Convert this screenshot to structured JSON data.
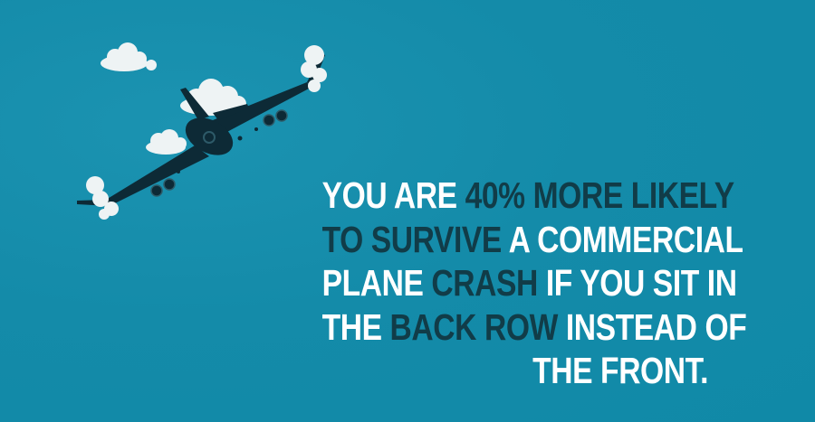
{
  "fact": {
    "lines": [
      [
        {
          "text": "YOU ARE ",
          "tone": "light"
        },
        {
          "text": "40% MORE LIKELY",
          "tone": "dark"
        }
      ],
      [
        {
          "text": "TO SURVIVE",
          "tone": "dark"
        },
        {
          "text": " A COMMERCIAL",
          "tone": "light"
        }
      ],
      [
        {
          "text": "PLANE ",
          "tone": "light"
        },
        {
          "text": "CRASH",
          "tone": "dark"
        },
        {
          "text": " IF YOU SIT IN",
          "tone": "light"
        }
      ],
      [
        {
          "text": "THE ",
          "tone": "light"
        },
        {
          "text": "BACK ROW",
          "tone": "dark"
        },
        {
          "text": " INSTEAD OF",
          "tone": "light"
        }
      ],
      [
        {
          "text": "THE FRONT.",
          "tone": "light"
        }
      ]
    ]
  },
  "colors": {
    "background": "#128aa8",
    "text_light": "#ffffff",
    "text_dark": "#113c48",
    "plane": "#0d2a36",
    "cloud": "#eef3f4"
  },
  "illustration": {
    "icon": "airplane-icon",
    "clouds": [
      "cloud-icon",
      "cloud-icon",
      "cloud-icon",
      "cloud-icon",
      "cloud-icon"
    ]
  }
}
